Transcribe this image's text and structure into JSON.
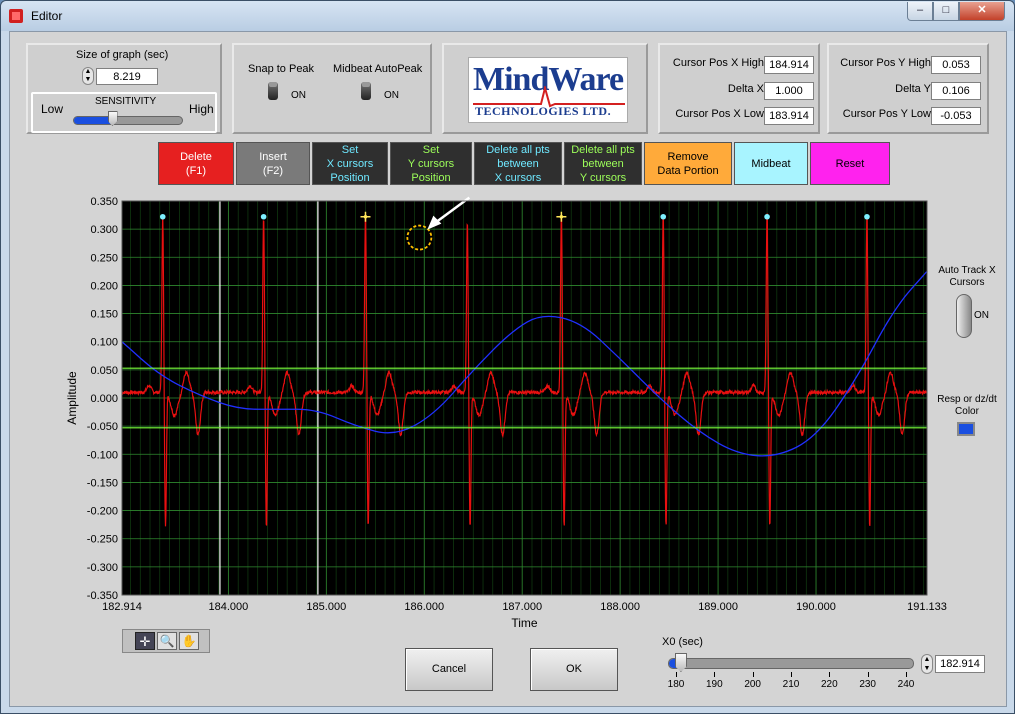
{
  "window": {
    "title": "Editor",
    "minimize": "–",
    "maximize": "□",
    "close": "✕"
  },
  "graph_size": {
    "label": "Size of graph (sec)",
    "value": "8.219"
  },
  "sensitivity": {
    "label": "SENSITIVITY",
    "low": "Low",
    "high": "High",
    "level": 0.35
  },
  "snap_to_peak": {
    "label": "Snap to Peak",
    "state": "ON"
  },
  "midbeat_autopeak": {
    "label": "Midbeat AutoPeak",
    "state": "ON"
  },
  "logo": {
    "line1": "MindWare",
    "line2": "TECHNOLOGIES LTD."
  },
  "cursors_x": {
    "high_label": "Cursor Pos X High",
    "high_value": "184.914",
    "delta_label": "Delta X",
    "delta_value": "1.000",
    "low_label": "Cursor Pos X Low",
    "low_value": "183.914"
  },
  "cursors_y": {
    "high_label": "Cursor Pos Y High",
    "high_value": "0.053",
    "delta_label": "Delta Y",
    "delta_value": "0.106",
    "low_label": "Cursor Pos Y Low",
    "low_value": "-0.053"
  },
  "toolbar": {
    "delete": "Delete\n(F1)",
    "insert": "Insert\n(F2)",
    "set_x": "Set\nX cursors\nPosition",
    "set_y": "Set\nY cursors\nPosition",
    "delete_between_x": "Delete all pts\nbetween\nX cursors",
    "delete_between_y": "Delete all pts\nbetween\nY cursors",
    "remove_portion": "Remove\nData Portion",
    "midbeat": "Midbeat",
    "reset": "Reset"
  },
  "colors": {
    "delete_bg": "#e62020",
    "insert_bg": "#7a7a7a",
    "dark_btn_bg": "#2f2f2f",
    "remove_bg": "#ffaa3a",
    "midbeat_bg": "#a8f4ff",
    "reset_bg": "#ff22ee",
    "plot_bg": "#000000",
    "grid": "#1f6a1f",
    "ecg": "#e81010",
    "resp": "#2030ff",
    "y_cursor": "#7cff3a",
    "x_cursor": "#ffffff",
    "resp_color_swatch": "#1a4fe0"
  },
  "chart_data": {
    "type": "line",
    "xlabel": "Time",
    "ylabel": "Amplitude",
    "xlim": [
      182.914,
      191.133
    ],
    "ylim": [
      -0.35,
      0.35
    ],
    "x_ticks": [
      "182.914",
      "184.000",
      "185.000",
      "186.000",
      "187.000",
      "188.000",
      "189.000",
      "190.000",
      "191.133"
    ],
    "x_tick_values": [
      182.914,
      184.0,
      185.0,
      186.0,
      187.0,
      188.0,
      189.0,
      190.0,
      191.133
    ],
    "y_ticks": [
      "0.350",
      "0.300",
      "0.250",
      "0.200",
      "0.150",
      "0.100",
      "0.050",
      "0.000",
      "-0.050",
      "-0.100",
      "-0.150",
      "-0.200",
      "-0.250",
      "-0.300",
      "-0.350"
    ],
    "y_tick_values": [
      0.35,
      0.3,
      0.25,
      0.2,
      0.15,
      0.1,
      0.05,
      0.0,
      -0.05,
      -0.1,
      -0.15,
      -0.2,
      -0.25,
      -0.3,
      -0.35
    ],
    "grid": true,
    "x_cursors": [
      183.914,
      184.914
    ],
    "y_cursors": [
      0.053,
      -0.053
    ],
    "r_peaks": [
      {
        "t": 183.33,
        "peak": 0.32,
        "marker": "dot"
      },
      {
        "t": 184.36,
        "peak": 0.315,
        "marker": "dot"
      },
      {
        "t": 185.4,
        "peak": 0.32,
        "marker": "star"
      },
      {
        "t": 186.44,
        "peak": 0.305,
        "marker": "none"
      },
      {
        "t": 187.4,
        "peak": 0.32,
        "marker": "star"
      },
      {
        "t": 188.44,
        "peak": 0.32,
        "marker": "dot"
      },
      {
        "t": 189.5,
        "peak": 0.325,
        "marker": "dot"
      },
      {
        "t": 190.52,
        "peak": 0.32,
        "marker": "dot"
      }
    ],
    "resp_series": {
      "x": [
        182.914,
        183.3,
        183.7,
        184.1,
        184.5,
        184.9,
        185.3,
        185.7,
        186.1,
        186.5,
        186.9,
        187.2,
        187.6,
        188.0,
        188.4,
        188.8,
        189.2,
        189.6,
        190.0,
        190.4,
        190.8,
        191.133
      ],
      "y": [
        0.1,
        0.04,
        0.005,
        -0.02,
        -0.02,
        -0.02,
        -0.05,
        -0.068,
        -0.03,
        0.05,
        0.12,
        0.15,
        0.135,
        0.07,
        0.0,
        -0.06,
        -0.1,
        -0.105,
        -0.07,
        0.03,
        0.16,
        0.225
      ]
    },
    "annotation": {
      "type": "circle",
      "t": 185.95,
      "y": 0.285
    }
  },
  "auto_track": {
    "label": "Auto Track X Cursors",
    "state": "ON"
  },
  "resp_color": {
    "label": "Resp or dz/dt Color"
  },
  "buttons": {
    "cancel": "Cancel",
    "ok": "OK"
  },
  "x0": {
    "label": "X0 (sec)",
    "value": "182.914",
    "min": 180,
    "max": 240,
    "ticks": [
      "180",
      "190",
      "200",
      "210",
      "220",
      "230",
      "240"
    ],
    "level": 182.914
  }
}
